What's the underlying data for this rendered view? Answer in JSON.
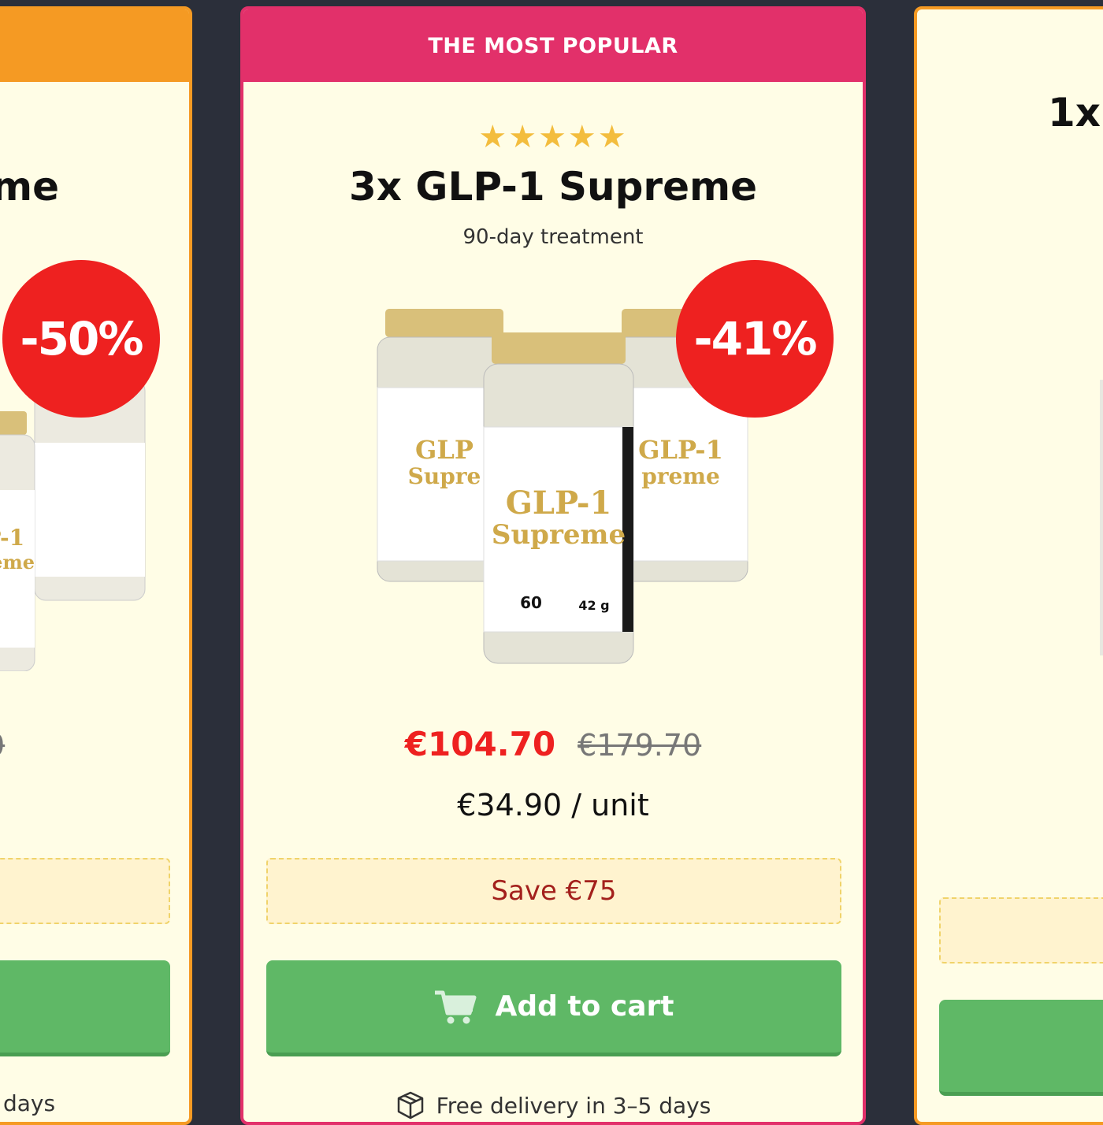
{
  "cards": {
    "left": {
      "header": "",
      "title": "me",
      "discount": "-50%",
      "price_old": "0",
      "save": "",
      "cart": "",
      "delivery": "days"
    },
    "middle": {
      "header": "THE MOST POPULAR",
      "rating_stars": "★★★★★",
      "rating": 5,
      "title": "3x GLP-1 Supreme",
      "subtitle": "90-day treatment",
      "discount": "-41%",
      "price_new": "€104.70",
      "price_old": "€179.70",
      "unit_price": "€34.90 / unit",
      "save": "Save €75",
      "cart": "Add to cart",
      "delivery": "Free delivery in 3–5 days"
    },
    "right": {
      "title": "1x"
    }
  },
  "product_label": {
    "name_line1": "GLP-1",
    "name_line2": "Supreme",
    "count": "60",
    "weight": "42 g"
  },
  "colors": {
    "background": "#2b2f3a",
    "card_bg": "#fffde6",
    "popular_accent": "#e2306a",
    "orange_accent": "#f59a23",
    "discount_red": "#ee2120",
    "cart_green": "#5fb866",
    "star_gold": "#f3bd3e"
  },
  "icons": [
    "star-icon",
    "cart-icon",
    "box-icon"
  ]
}
